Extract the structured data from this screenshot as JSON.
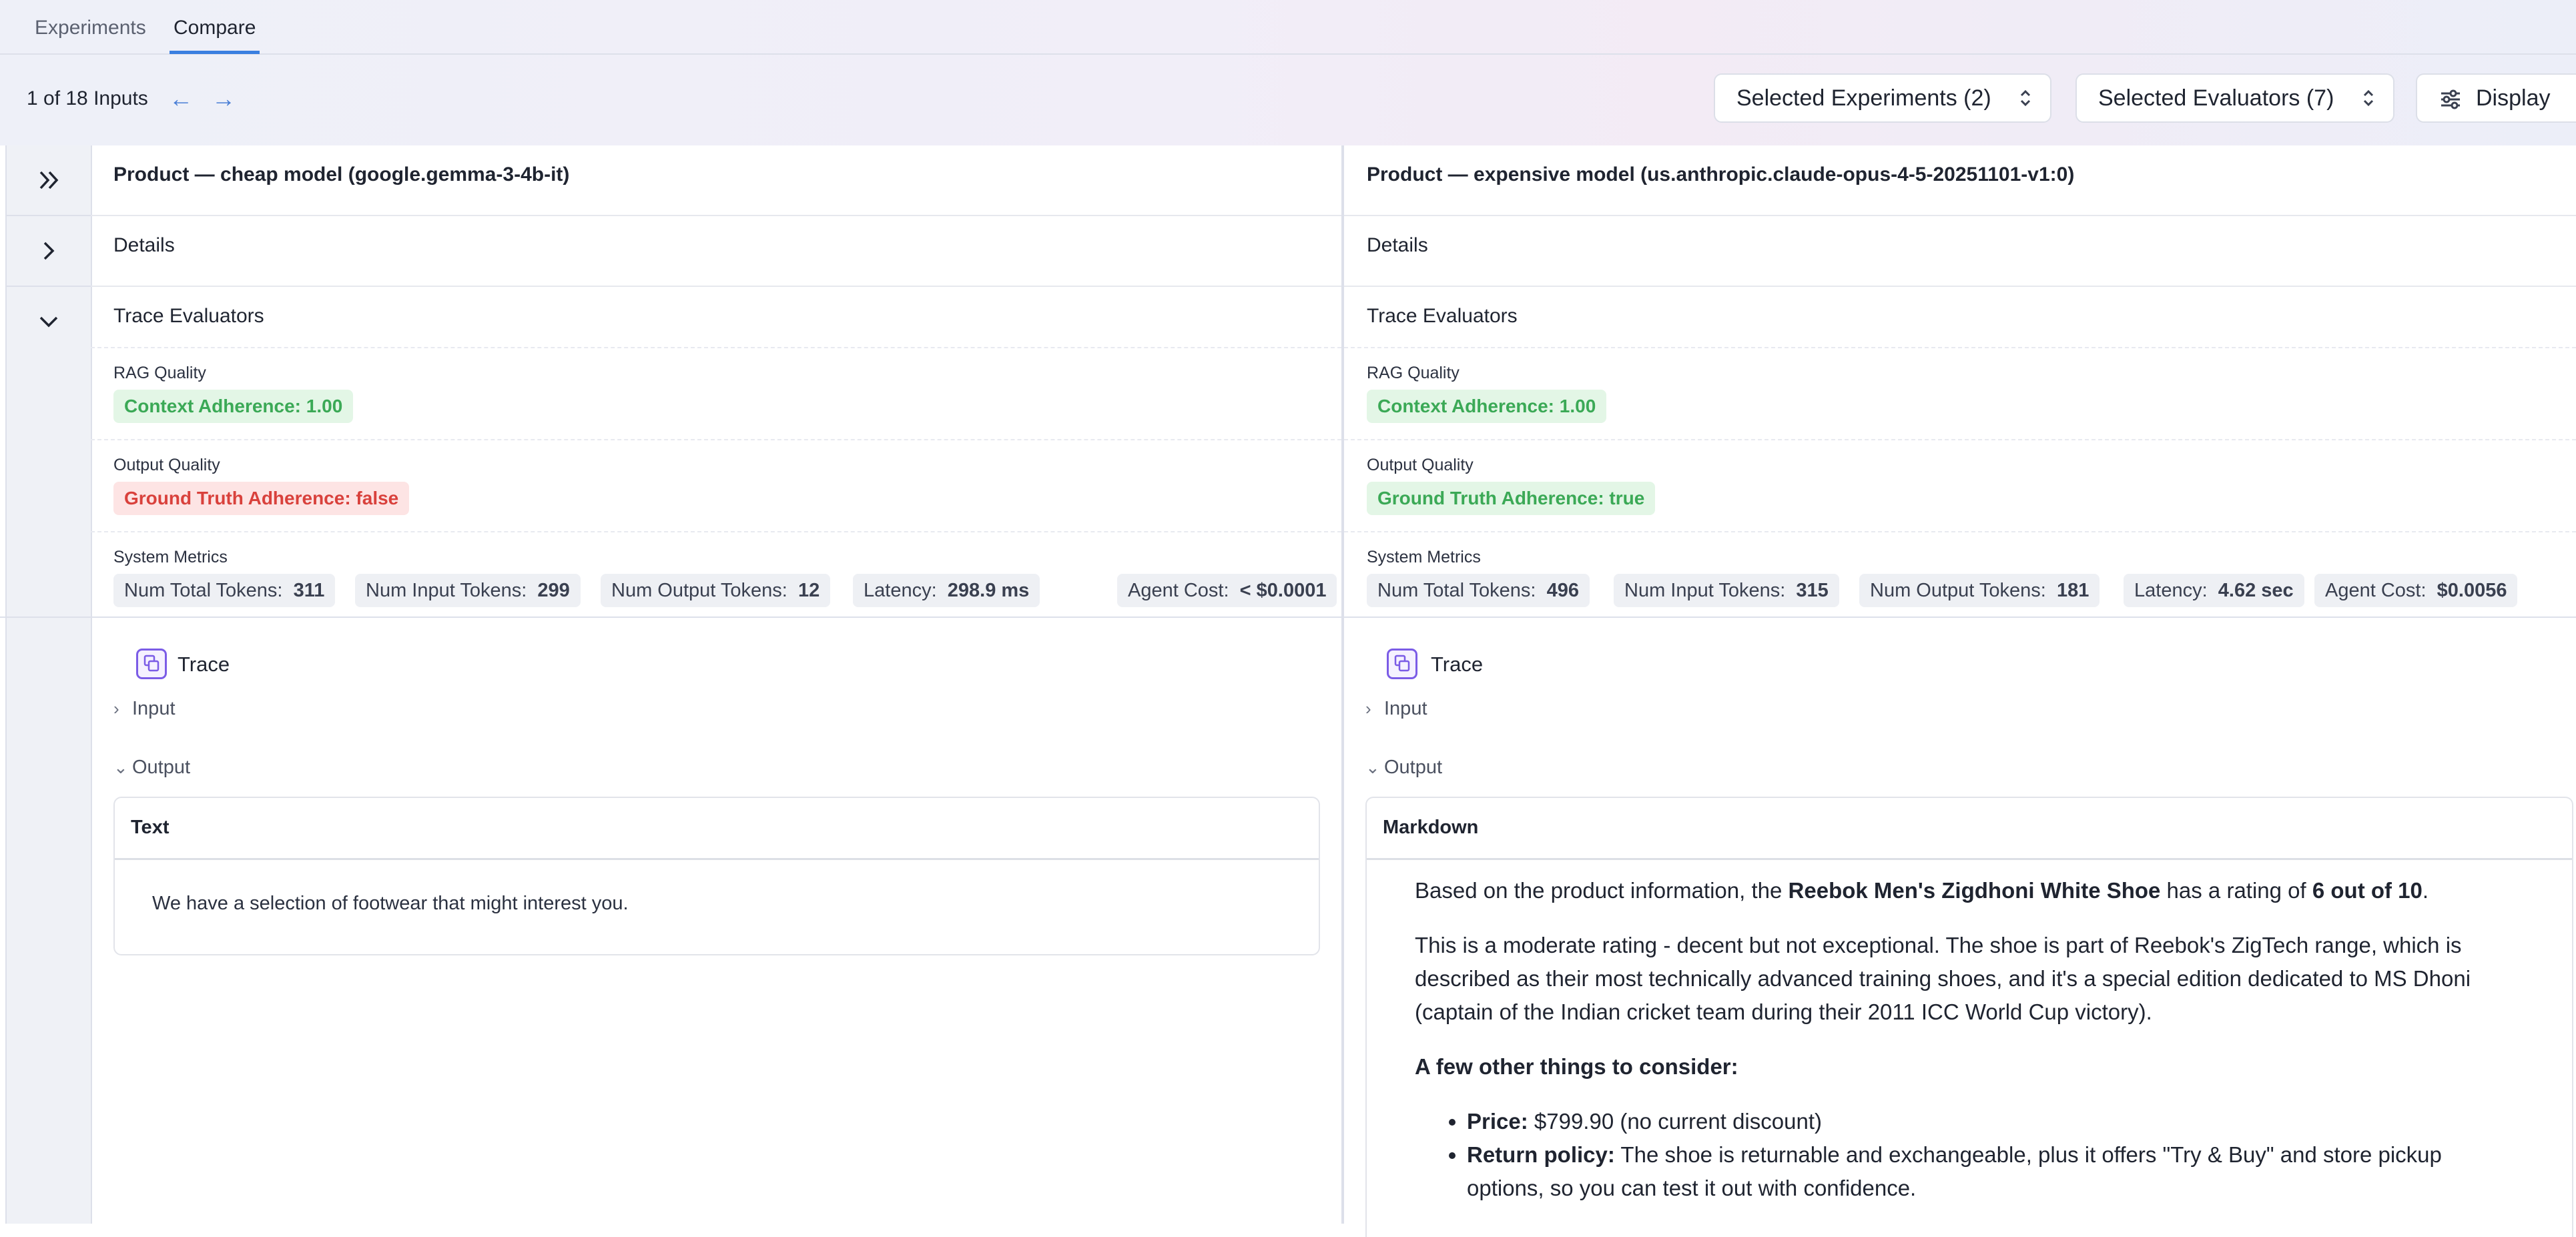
{
  "tabs": [
    {
      "label": "Experiments",
      "active": false
    },
    {
      "label": "Compare",
      "active": true
    }
  ],
  "toolbar": {
    "counter": "1 of 18 Inputs",
    "selected_experiments": "Selected Experiments (2)",
    "selected_evaluators": "Selected Evaluators (7)",
    "display": "Display"
  },
  "colors": {
    "accent": "#3a7fe0",
    "green_text": "#3ba956",
    "green_bg": "#e3f6e6",
    "red_text": "#d9413c",
    "red_bg": "#fde4e4",
    "trace_icon": "#7b5ce6"
  },
  "columns": [
    {
      "title": "Product — cheap model (google.gemma-3-4b-it)",
      "details": "Details",
      "trace_evaluators": "Trace Evaluators",
      "rag_label": "RAG Quality",
      "rag_badge": "Context Adherence:  1.00",
      "output_quality_label": "Output Quality",
      "output_badge": "Ground Truth Adherence:  false",
      "system_metrics_label": "System Metrics",
      "metrics": [
        {
          "label": "Num Total Tokens:",
          "value": "311"
        },
        {
          "label": "Num Input Tokens:",
          "value": "299"
        },
        {
          "label": "Num Output Tokens:",
          "value": "12"
        },
        {
          "label": "Latency:",
          "value": "298.9 ms"
        },
        {
          "label": "Agent Cost:",
          "value": "< $0.0001"
        }
      ],
      "trace": "Trace",
      "input_label": "Input",
      "output_label": "Output",
      "output_type": "Text",
      "output_text": "We have a selection of footwear that might interest you."
    },
    {
      "title": "Product — expensive model (us.anthropic.claude-opus-4-5-20251101-v1:0)",
      "details": "Details",
      "trace_evaluators": "Trace Evaluators",
      "rag_label": "RAG Quality",
      "rag_badge": "Context Adherence:  1.00",
      "output_quality_label": "Output Quality",
      "output_badge": "Ground Truth Adherence:  true",
      "system_metrics_label": "System Metrics",
      "metrics": [
        {
          "label": "Num Total Tokens:",
          "value": "496"
        },
        {
          "label": "Num Input Tokens:",
          "value": "315"
        },
        {
          "label": "Num Output Tokens:",
          "value": "181"
        },
        {
          "label": "Latency:",
          "value": "4.62 sec"
        },
        {
          "label": "Agent Cost:",
          "value": "$0.0056"
        }
      ],
      "trace": "Trace",
      "input_label": "Input",
      "output_label": "Output",
      "output_type": "Markdown",
      "md": {
        "p1_a": "Based on the product information, the ",
        "p1_b": "Reebok Men's Zigdhoni White Shoe",
        "p1_c": " has a rating of ",
        "p1_d": "6 out of 10",
        "p1_e": ".",
        "p2": "This is a moderate rating - decent but not exceptional. The shoe is part of Reebok's ZigTech range, which is described as their most technically advanced training shoes, and it's a special edition dedicated to MS Dhoni (captain of the Indian cricket team during their 2011 ICC World Cup victory).",
        "p3": "A few other things to consider:",
        "li1_b": "Price:",
        "li1": " $799.90 (no current discount)",
        "li2_b": "Return policy:",
        "li2": " The shoe is returnable and exchangeable, plus it offers \"Try & Buy\" and store pickup options, so you can test it out with confidence."
      }
    }
  ]
}
